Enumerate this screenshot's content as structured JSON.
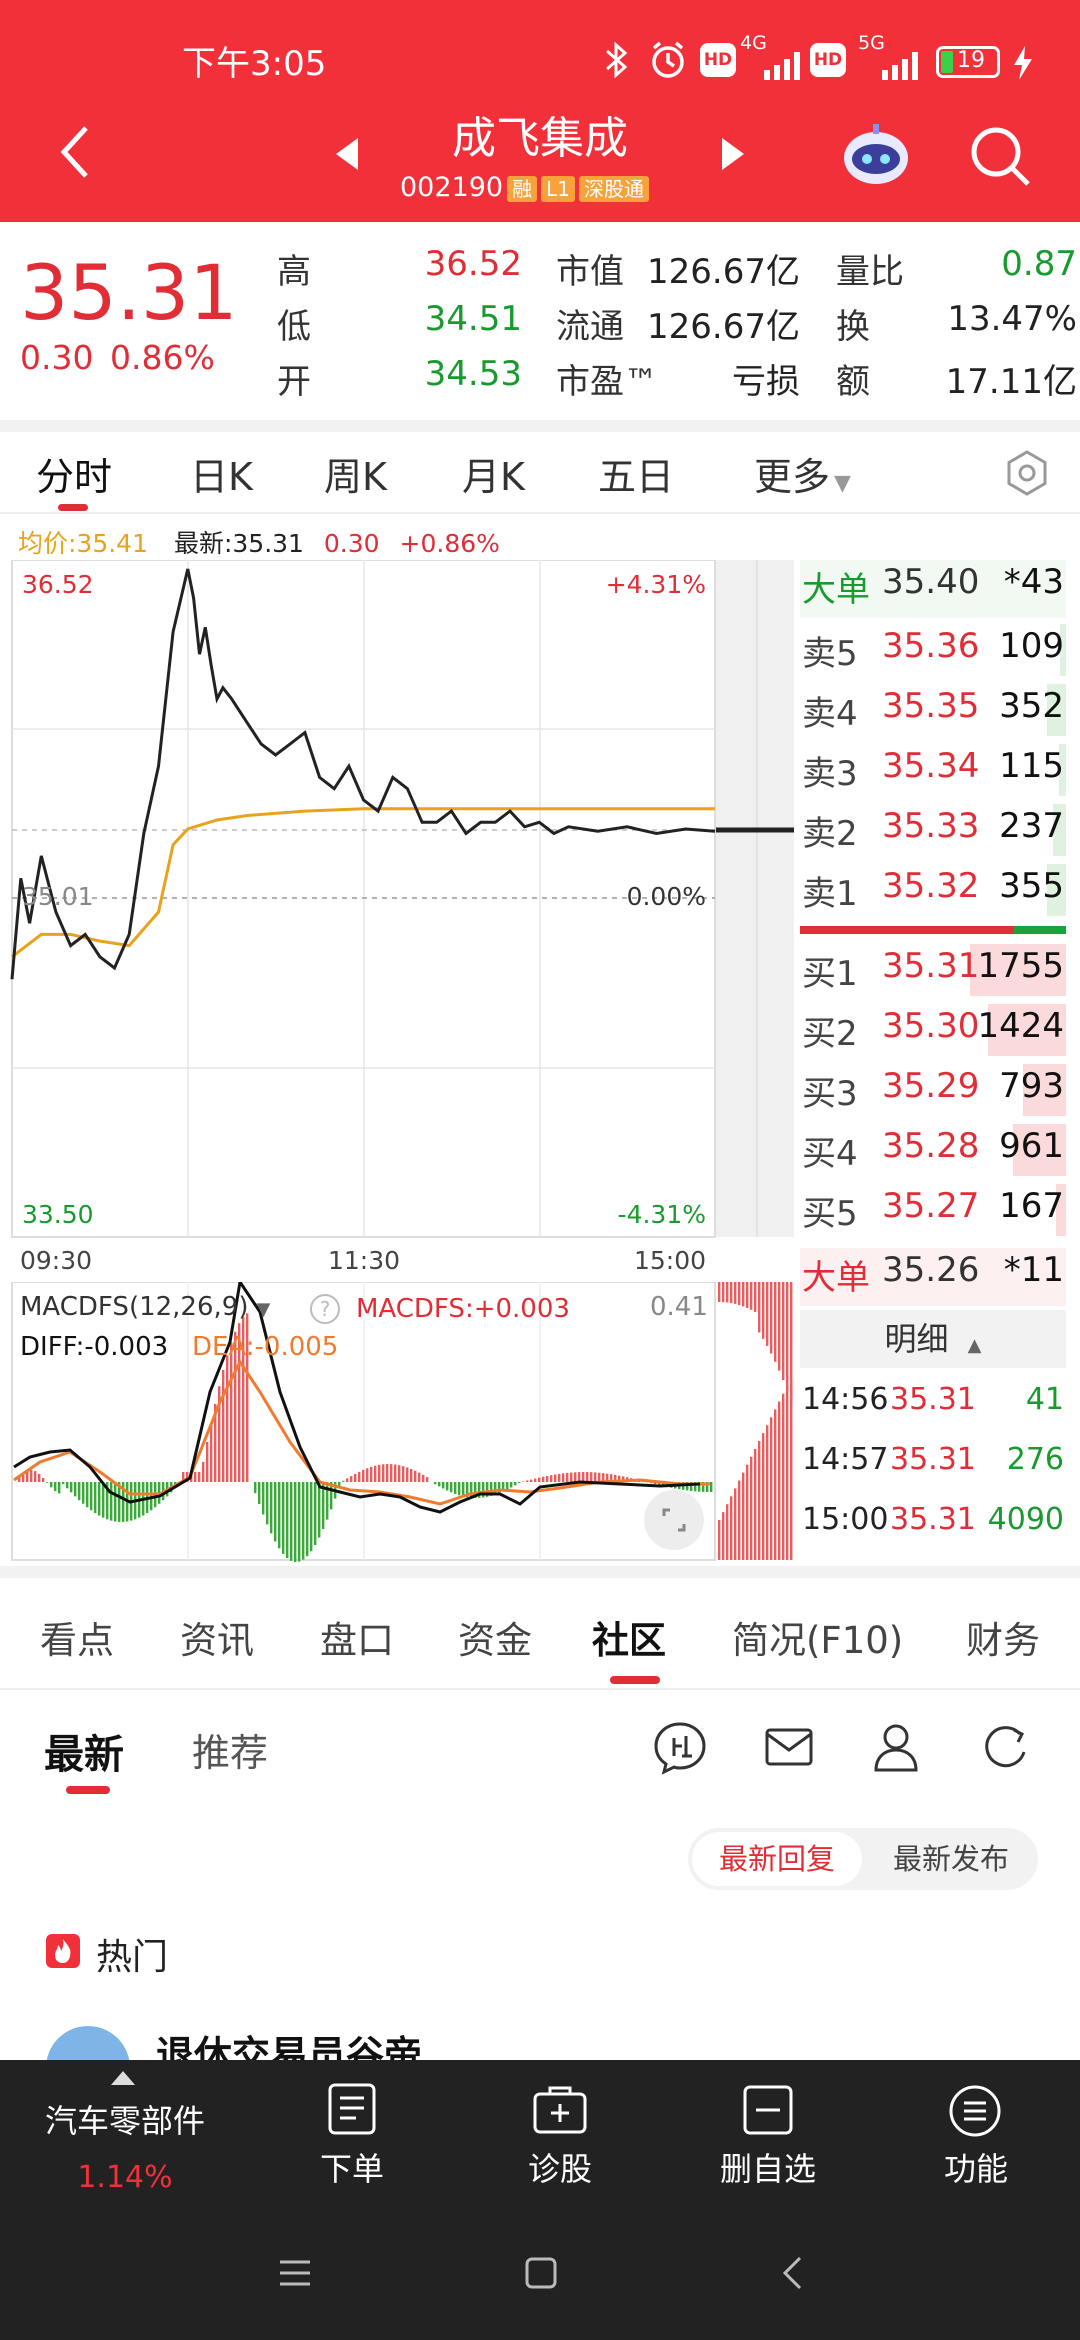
{
  "status_bar": {
    "time": "下午3:05",
    "network_1": "4G",
    "network_2": "5G",
    "battery": "19"
  },
  "header": {
    "title": "成飞集成",
    "code": "002190",
    "tags": [
      "融",
      "L1",
      "深股通"
    ]
  },
  "quote": {
    "price": "35.31",
    "change": "0.30",
    "change_pct": "0.86%",
    "high_label": "高",
    "high": "36.52",
    "low_label": "低",
    "low": "34.51",
    "open_label": "开",
    "open": "34.53",
    "mktcap_label": "市值",
    "mktcap": "126.67亿",
    "float_label": "流通",
    "float": "126.67亿",
    "pe_label": "市盈™",
    "pe": "亏损",
    "volratio_label": "量比",
    "volratio": "0.87",
    "turnover_label": "换",
    "turnover": "13.47%",
    "amount_label": "额",
    "amount": "17.11亿"
  },
  "chart_tabs": [
    "分时",
    "日K",
    "周K",
    "月K",
    "五日",
    "更多"
  ],
  "chart_info": {
    "avg_label": "均价:35.41",
    "latest_label": "最新:35.31",
    "change": "0.30",
    "change_pct": "+0.86%"
  },
  "chart_labels": {
    "y_top": "36.52",
    "y_mid": "35.01",
    "y_bottom": "33.50",
    "pct_top": "+4.31%",
    "pct_mid": "0.00%",
    "pct_bottom": "-4.31%",
    "x_start": "09:30",
    "x_mid": "11:30",
    "x_end": "15:00"
  },
  "chart_data": {
    "type": "line",
    "x_range": [
      "09:30",
      "15:00"
    ],
    "ylim": [
      33.5,
      36.52
    ],
    "series": [
      {
        "name": "最新",
        "color": "#222222",
        "x": [
          0,
          3,
          6,
          10,
          15,
          20,
          25,
          30,
          35,
          40,
          45,
          50,
          55,
          60,
          62,
          64,
          66,
          68,
          70,
          72,
          75,
          80,
          85,
          90,
          95,
          100,
          105,
          110,
          115,
          120,
          125,
          130,
          135,
          140,
          145,
          150,
          155,
          160,
          165,
          170,
          175,
          180,
          185,
          190,
          200,
          210,
          220,
          230,
          240
        ],
        "y": [
          34.65,
          35.1,
          34.9,
          35.2,
          34.95,
          34.8,
          34.85,
          34.75,
          34.7,
          34.85,
          35.3,
          35.6,
          36.2,
          36.48,
          36.35,
          36.1,
          36.22,
          36.05,
          35.9,
          35.95,
          35.9,
          35.8,
          35.7,
          35.65,
          35.7,
          35.75,
          35.55,
          35.5,
          35.6,
          35.45,
          35.4,
          35.55,
          35.5,
          35.35,
          35.35,
          35.4,
          35.3,
          35.35,
          35.35,
          35.4,
          35.33,
          35.35,
          35.3,
          35.33,
          35.31,
          35.33,
          35.3,
          35.32,
          35.31
        ]
      },
      {
        "name": "均价",
        "color": "#e8a21c",
        "x": [
          0,
          10,
          20,
          30,
          40,
          50,
          55,
          60,
          70,
          80,
          100,
          120,
          140,
          160,
          180,
          200,
          220,
          240
        ],
        "y": [
          34.75,
          34.85,
          34.85,
          34.82,
          34.8,
          34.95,
          35.25,
          35.32,
          35.36,
          35.38,
          35.4,
          35.41,
          35.41,
          35.41,
          35.41,
          35.41,
          35.41,
          35.41
        ]
      }
    ]
  },
  "order_book": {
    "big_sell": {
      "label": "大单",
      "price": "35.40",
      "vol": "*43"
    },
    "sells": [
      {
        "label": "卖5",
        "price": "35.36",
        "vol": "109",
        "ratio": 0.06
      },
      {
        "label": "卖4",
        "price": "35.35",
        "vol": "352",
        "ratio": 0.2
      },
      {
        "label": "卖3",
        "price": "35.34",
        "vol": "115",
        "ratio": 0.07
      },
      {
        "label": "卖2",
        "price": "35.33",
        "vol": "237",
        "ratio": 0.14
      },
      {
        "label": "卖1",
        "price": "35.32",
        "vol": "355",
        "ratio": 0.2
      }
    ],
    "buys": [
      {
        "label": "买1",
        "price": "35.31",
        "vol": "1755",
        "ratio": 1.0
      },
      {
        "label": "买2",
        "price": "35.30",
        "vol": "1424",
        "ratio": 0.81
      },
      {
        "label": "买3",
        "price": "35.29",
        "vol": "793",
        "ratio": 0.45
      },
      {
        "label": "买4",
        "price": "35.28",
        "vol": "961",
        "ratio": 0.55
      },
      {
        "label": "买5",
        "price": "35.27",
        "vol": "167",
        "ratio": 0.1
      }
    ],
    "big_buy": {
      "label": "大单",
      "price": "35.26",
      "vol": "*11"
    },
    "detail_label": "明细",
    "ticks": [
      {
        "time": "14:56",
        "price": "35.31",
        "vol": "41"
      },
      {
        "time": "14:57",
        "price": "35.31",
        "vol": "276"
      },
      {
        "time": "15:00",
        "price": "35.31",
        "vol": "4090"
      }
    ]
  },
  "macd": {
    "name": "MACDFS(12,26,9)",
    "value_label": "MACDFS:+0.003",
    "diff": "DIFF:-0.003",
    "dea": "DEA:-0.005",
    "scale": "0.41"
  },
  "section_tabs": [
    "看点",
    "资讯",
    "盘口",
    "资金",
    "社区",
    "简况(F10)",
    "财务"
  ],
  "community": {
    "sub_tabs": [
      "最新",
      "推荐"
    ],
    "sort_options": [
      "最新回复",
      "最新发布"
    ],
    "hot_label": "热门",
    "first_post_user": "退休交易员谷帝"
  },
  "bottom_bar": {
    "sector_name": "汽车零部件",
    "sector_change": "1.14%",
    "items": [
      "下单",
      "诊股",
      "删自选",
      "功能"
    ]
  }
}
